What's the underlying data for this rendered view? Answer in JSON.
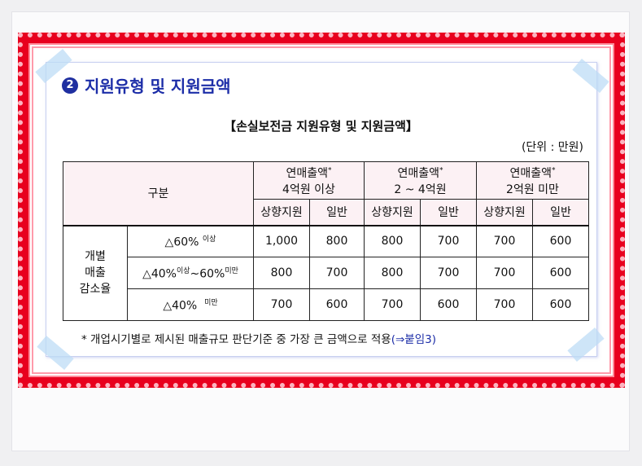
{
  "section": {
    "number": "2",
    "title": "지원유형 및 지원금액"
  },
  "table_title": "【손실보전금 지원유형 및 지원금액】",
  "unit": "(단위 : 만원)",
  "table": {
    "corner": "구분",
    "groups": [
      {
        "line1": "연매출액",
        "star": "*",
        "line2": "4억원 이상"
      },
      {
        "line1": "연매출액",
        "star": "*",
        "line2": "2 ~ 4억원"
      },
      {
        "line1": "연매출액",
        "star": "*",
        "line2": "2억원 미만"
      }
    ],
    "sub": [
      "상향지원",
      "일반",
      "상향지원",
      "일반",
      "상향지원",
      "일반"
    ],
    "row_group": [
      "개별",
      "매출",
      "감소율"
    ],
    "rows": [
      {
        "label": "△60%",
        "sup1": "이상",
        "mid": "",
        "sup2": "",
        "values": [
          "1,000",
          "800",
          "800",
          "700",
          "700",
          "600"
        ]
      },
      {
        "label": "△40%",
        "sup1": "이상",
        "mid": "~60%",
        "sup2": "미만",
        "values": [
          "800",
          "700",
          "800",
          "700",
          "700",
          "600"
        ]
      },
      {
        "label": "△40%",
        "sup1": "",
        "mid": "",
        "sup2": "미만",
        "values": [
          "700",
          "600",
          "700",
          "600",
          "700",
          "600"
        ]
      }
    ]
  },
  "footnote": {
    "text": "* 개업시기별로 제시된 매출규모 판단기준 중 가장 큰 금액으로 적용",
    "link": "(⇒붙임3)"
  },
  "colors": {
    "frame": "#e8001e",
    "title": "#1d2ea8",
    "header_bg": "#fcf1f4"
  }
}
